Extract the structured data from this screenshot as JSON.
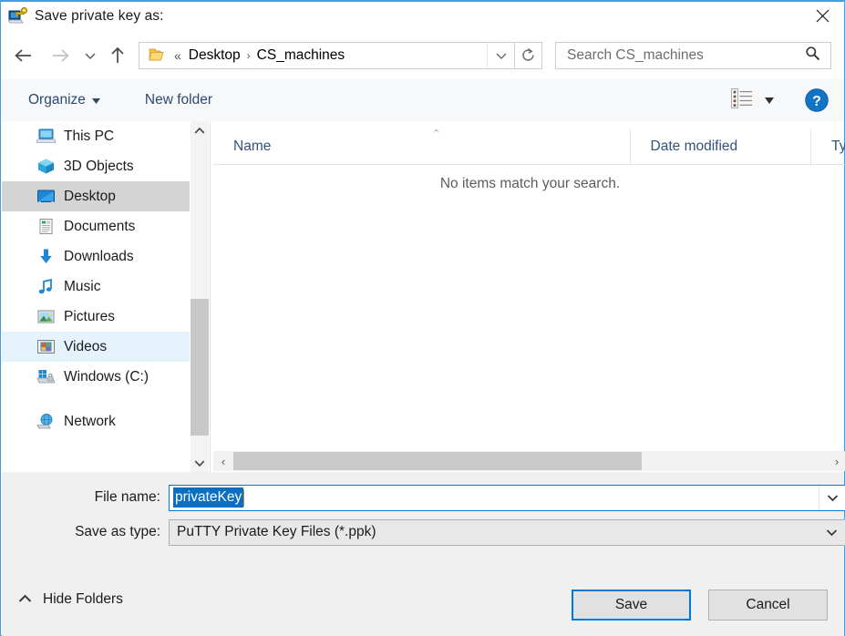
{
  "window": {
    "title": "Save private key as:",
    "app_icon": "putty-key-icon",
    "close_label": "✕",
    "accent_color": "#0078d7",
    "titlebar_border_color": "#4a9ddb"
  },
  "nav": {
    "back_icon": "arrow-left-icon",
    "forward_icon": "arrow-right-icon",
    "recent_icon": "chevron-down-icon",
    "up_icon": "arrow-up-icon",
    "refresh_icon": "refresh-icon",
    "dropdown_icon": "chevron-down-icon",
    "breadcrumb": {
      "folder_icon": "folder-icon",
      "overflow": "«",
      "separator": "›",
      "segments": [
        "Desktop",
        "CS_machines"
      ]
    }
  },
  "search": {
    "placeholder": "Search CS_machines",
    "icon": "search-icon"
  },
  "toolbar": {
    "organize_label": "Organize",
    "organize_caret": "▾",
    "new_folder_label": "New folder",
    "view_icon": "list-view-icon",
    "view_caret": "▾",
    "help_icon": "help-icon",
    "help_glyph": "?",
    "text_color": "#2b4a6f"
  },
  "sidebar": {
    "items": [
      {
        "label": "This PC",
        "icon": "computer-icon",
        "state": "normal"
      },
      {
        "label": "3D Objects",
        "icon": "cube-icon",
        "state": "normal"
      },
      {
        "label": "Desktop",
        "icon": "desktop-icon",
        "state": "selected"
      },
      {
        "label": "Documents",
        "icon": "document-icon",
        "state": "normal"
      },
      {
        "label": "Downloads",
        "icon": "download-icon",
        "state": "normal"
      },
      {
        "label": "Music",
        "icon": "music-icon",
        "state": "normal"
      },
      {
        "label": "Pictures",
        "icon": "picture-icon",
        "state": "normal"
      },
      {
        "label": "Videos",
        "icon": "video-icon",
        "state": "hover"
      },
      {
        "label": "Windows (C:)",
        "icon": "drive-icon",
        "state": "normal"
      },
      {
        "label": "Network",
        "icon": "network-icon",
        "state": "normal"
      }
    ],
    "scroll_up_icon": "chevron-up-icon",
    "scroll_down_icon": "chevron-down-icon",
    "selected_bg": "#d4d4d4",
    "hover_bg": "#e5f3fd"
  },
  "filelist": {
    "columns": [
      "Name",
      "Date modified",
      "Ty"
    ],
    "sort_indicator": "⌃",
    "rows": [],
    "empty_message": "No items match your search.",
    "hscroll_left_icon": "‹",
    "hscroll_right_icon": "›"
  },
  "form": {
    "filename_label": "File name:",
    "filename_value": "privateKey",
    "filename_selected": true,
    "filename_dropdown_icon": "chevron-down-icon",
    "filetype_label": "Save as type:",
    "filetype_value": "PuTTY Private Key Files (*.ppk)",
    "filetype_dropdown_icon": "chevron-down-icon",
    "selection_color": "#0a6fc2",
    "caret_color": "#d98d2b"
  },
  "footer": {
    "hide_folders_label": "Hide Folders",
    "hide_folders_icon": "chevron-up-icon",
    "save_label": "Save",
    "cancel_label": "Cancel"
  }
}
